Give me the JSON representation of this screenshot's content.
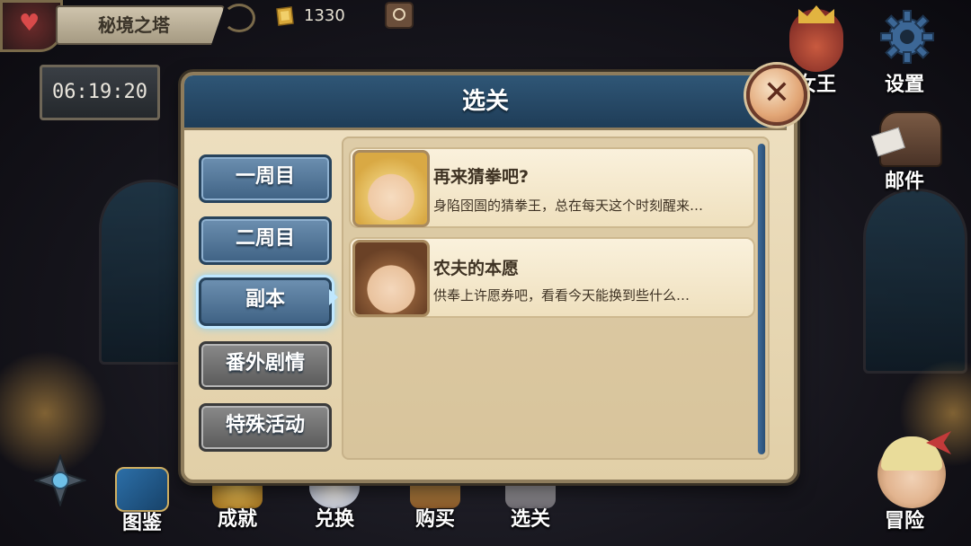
{
  "top_bar": {
    "location_title": "秘境之塔",
    "timer": "06:19:20",
    "currency_amount": "1330"
  },
  "right_menu": {
    "queen_label": "女王",
    "settings_label": "设置",
    "mail_label": "邮件"
  },
  "bottom_nav": {
    "items": [
      {
        "label": "图鉴",
        "icon": "codex-book-icon"
      },
      {
        "label": "成就",
        "icon": "trophy-icon"
      },
      {
        "label": "兑换",
        "icon": "exchange-icon"
      },
      {
        "label": "购买",
        "icon": "shop-icon"
      },
      {
        "label": "选关",
        "icon": "stage-select-icon"
      }
    ],
    "adventure_label": "冒险"
  },
  "modal": {
    "title": "选关",
    "tabs": [
      {
        "label": "一周目",
        "style": "blue"
      },
      {
        "label": "二周目",
        "style": "blue"
      },
      {
        "label": "副本",
        "style": "blue",
        "selected": true
      },
      {
        "label": "番外剧情",
        "style": "gray"
      },
      {
        "label": "特殊活动",
        "style": "gray"
      }
    ],
    "stages": [
      {
        "title": "再来猜拳吧?",
        "description": "身陷囹圄的猜拳王，总在每天这个时刻醒来…"
      },
      {
        "title": "农夫的本愿",
        "description": "供奉上许愿券吧，看看今天能换到些什么…"
      }
    ]
  },
  "colors": {
    "header_blue": "#2f5676",
    "panel_parchment": "#efe1c3",
    "tab_blue": "#4f7397",
    "tab_gray": "#6e6e6e",
    "active_glow": "#7ad0ff",
    "close_button": "#e2a676"
  }
}
